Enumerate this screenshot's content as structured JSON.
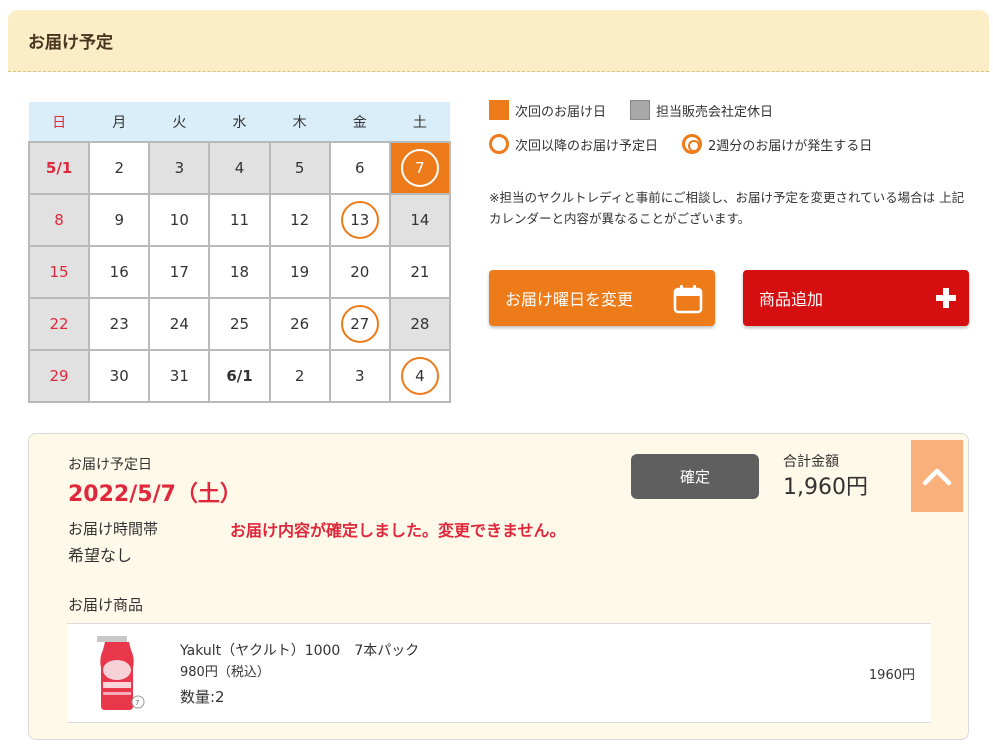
{
  "header": {
    "title": "お届け予定"
  },
  "calendar": {
    "weekdays": [
      "日",
      "月",
      "火",
      "水",
      "木",
      "金",
      "土"
    ],
    "weeks": [
      [
        "5/1",
        "2",
        "3",
        "4",
        "5",
        "6",
        "7"
      ],
      [
        "8",
        "9",
        "10",
        "11",
        "12",
        "13",
        "14"
      ],
      [
        "15",
        "16",
        "17",
        "18",
        "19",
        "20",
        "21"
      ],
      [
        "22",
        "23",
        "24",
        "25",
        "26",
        "27",
        "28"
      ],
      [
        "29",
        "30",
        "31",
        "6/1",
        "2",
        "3",
        "4"
      ]
    ]
  },
  "legend": {
    "next_delivery": "次回のお届け日",
    "holiday": "担当販売会社定休日",
    "future_delivery": "次回以降のお届け予定日",
    "double_delivery": "2週分のお届けが発生する日"
  },
  "note": "※担当のヤクルトレディと事前にご相談し、お届け予定を変更されている場合は 上記 カレンダーと内容が異なることがございます。",
  "buttons": {
    "change_day": "お届け曜日を変更",
    "add_product": "商品追加"
  },
  "colors": {
    "accent_orange": "#ee7b1a",
    "accent_red": "#d50f0f",
    "alert_red": "#e0283c",
    "header_bg": "#fbedc5"
  },
  "delivery": {
    "date_label": "お届け予定日",
    "date_value": "2022/5/7（土）",
    "time_label": "お届け時間帯",
    "time_value": "希望なし",
    "notice": "お届け内容が確定しました。変更できません。",
    "confirm_label": "確定",
    "total_label": "合計金額",
    "total_value": "1,960円",
    "items_label": "お届け商品",
    "items": [
      {
        "name": "Yakult（ヤクルト）1000　7本パック",
        "price": "980円（税込）",
        "quantity": "数量:2",
        "subtotal": "1960円",
        "image_icon": "yakult-bottle-icon"
      }
    ]
  }
}
